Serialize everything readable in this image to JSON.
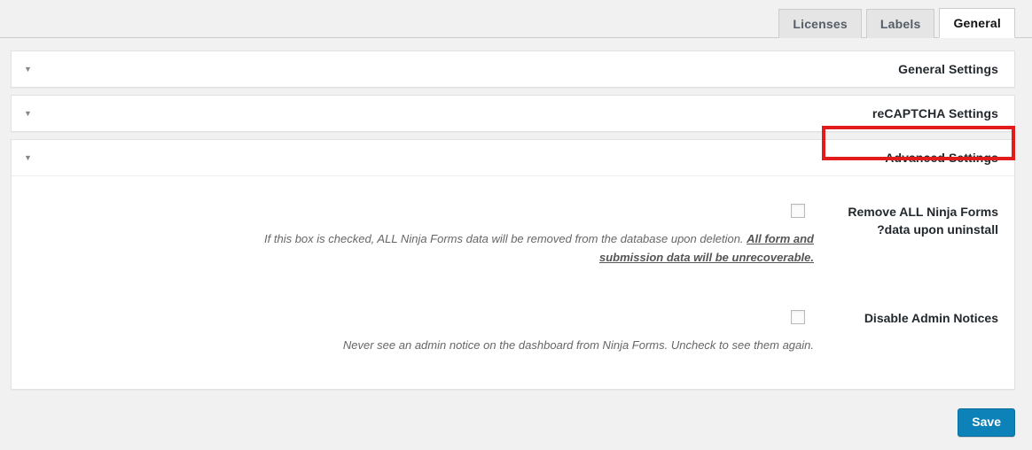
{
  "tabs": [
    {
      "label": "Licenses",
      "active": false
    },
    {
      "label": "Labels",
      "active": false
    },
    {
      "label": "General",
      "active": true
    }
  ],
  "panels": [
    {
      "title": "General Settings",
      "caret": "▼",
      "expanded": false,
      "highlighted": false
    },
    {
      "title": "reCAPTCHA Settings",
      "caret": "▼",
      "expanded": false,
      "highlighted": false
    },
    {
      "title": "Advanced Settings",
      "caret": "▼",
      "expanded": true,
      "highlighted": true
    }
  ],
  "settings": [
    {
      "label": "Remove ALL Ninja Forms data upon uninstall?",
      "checked": false,
      "desc_before": "If this box is checked, ALL Ninja Forms data will be removed from the database upon deletion. ",
      "desc_link": "All form and submission data will be unrecoverable.",
      "desc_after": ""
    },
    {
      "label": "Disable Admin Notices",
      "checked": false,
      "desc_before": "Never see an admin notice on the dashboard from Ninja Forms. Uncheck to see them again.",
      "desc_link": "",
      "desc_after": ""
    }
  ],
  "footer": {
    "save_label": "Save"
  },
  "colors": {
    "accent": "#0d82b8",
    "annotation": "#e21b1b",
    "page_background": "#f1f1f1",
    "panel_background": "#ffffff",
    "heading_text": "#23282d",
    "description_text": "#666666"
  }
}
